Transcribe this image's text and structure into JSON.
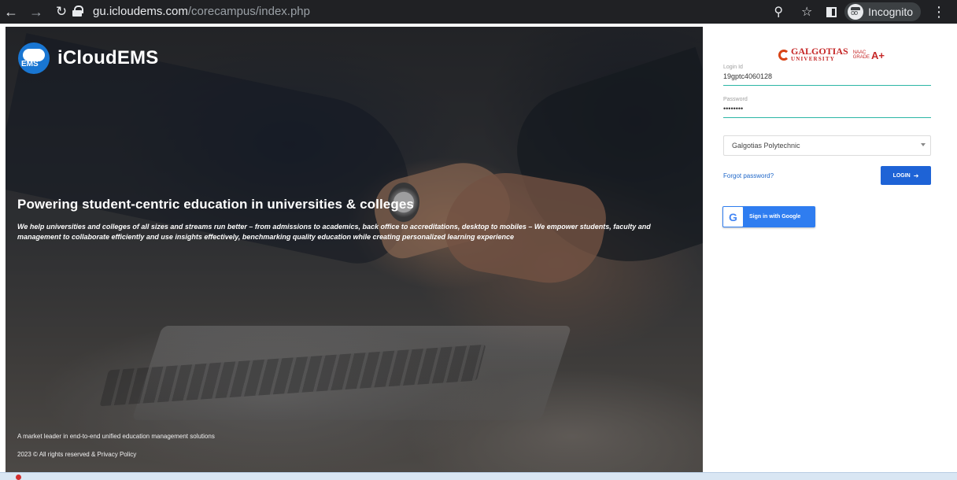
{
  "browser": {
    "url_host": "gu.icloudems.com",
    "url_path": "/corecampus/index.php",
    "incognito_label": "Incognito"
  },
  "hero": {
    "brand_name": "iCloudEMS",
    "headline": "Powering student-centric education in universities & colleges",
    "subtext": "We help universities and colleges of all sizes and streams run better – from admissions to academics, back office to accreditations, desktop to mobiles – We empower students, faculty and management to collaborate efficiently and use insights effectively, benchmarking quality education while creating personalized learning experience",
    "tagline": "A market leader in end-to-end unified education management solutions",
    "copyright": "2023 © All rights reserved & Privacy Policy"
  },
  "login": {
    "logo_name": "GALGOTIAS",
    "logo_sub": "UNIVERSITY",
    "naac_top": "NAAC",
    "naac_mid": "GRADE",
    "naac_grade": "A+",
    "login_id_label": "Login Id",
    "login_id_value": "19gptc4060128",
    "password_label": "Password",
    "password_value": "••••••••",
    "institute_value": "Galgotias Polytechnic",
    "forgot_label": "Forgot password?",
    "login_button": "LOGIN",
    "google_button": "Sign in with Google"
  },
  "colors": {
    "login_button": "#1e63d6",
    "google_button": "#2f7df0",
    "field_underline": "#2bb6a5",
    "brand_red": "#c62828"
  }
}
